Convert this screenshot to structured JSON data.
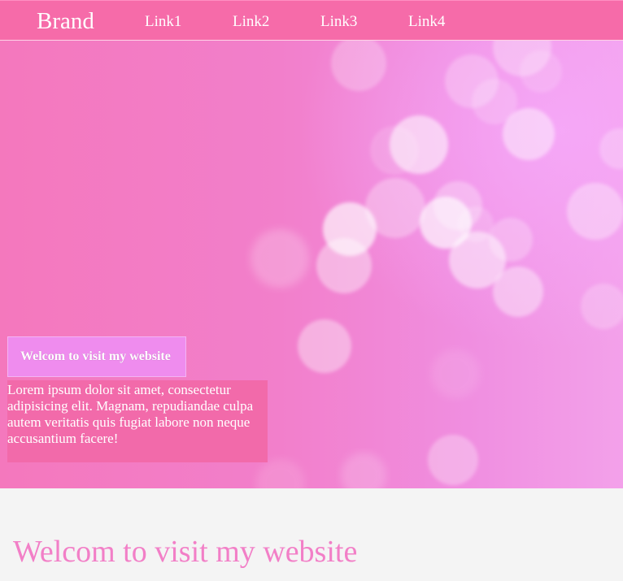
{
  "navbar": {
    "brand": "Brand",
    "links": [
      "Link1",
      "Link2",
      "Link3",
      "Link4"
    ]
  },
  "hero": {
    "tagline": "Welcom to visit my website",
    "description": "Lorem ipsum dolor sit amet, consectetur adipisicing elit. Magnam, repudiandae culpa autem veritatis quis fugiat labore non neque accusantium facere!"
  },
  "section": {
    "title": "Welcom to visit my website"
  },
  "colors": {
    "navbar": "#f66ba9",
    "hero_text_box": "#f26aaa",
    "hero_tag_box": "#ef8cee",
    "section_title": "#f27fc7",
    "page_background": "#f4f4f4"
  }
}
